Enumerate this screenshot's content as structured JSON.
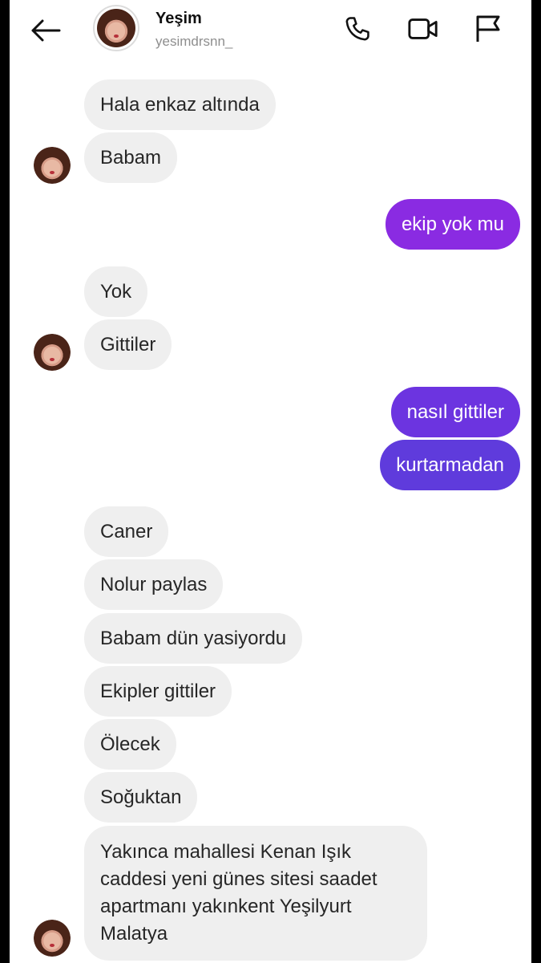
{
  "header": {
    "name": "Yeşim",
    "username": "yesimdrsnn_",
    "icons": [
      "back-arrow-icon",
      "phone-icon",
      "video-camera-icon",
      "flag-icon"
    ]
  },
  "colors": {
    "incoming_bg": "#efefef",
    "outgoing_purple": "#8a2be2",
    "outgoing_indigo": "#6435dd"
  },
  "messages": [
    {
      "from": "them",
      "text": "Hala enkaz altında"
    },
    {
      "from": "them",
      "text": "Babam"
    },
    {
      "from": "me",
      "text": "ekip yok mu"
    },
    {
      "from": "them",
      "text": "Yok"
    },
    {
      "from": "them",
      "text": "Gittiler"
    },
    {
      "from": "me",
      "text": "nasıl gittiler"
    },
    {
      "from": "me",
      "text": "kurtarmadan"
    },
    {
      "from": "them",
      "text": "Caner"
    },
    {
      "from": "them",
      "text": "Nolur paylas"
    },
    {
      "from": "them",
      "text": "Babam dün yasiyordu"
    },
    {
      "from": "them",
      "text": "Ekipler gittiler"
    },
    {
      "from": "them",
      "text": "Ölecek"
    },
    {
      "from": "them",
      "text": "Soğuktan"
    },
    {
      "from": "them",
      "text": "Yakınca mahallesi Kenan Işık caddesi yeni günes sitesi saadet apartmanı yakınkent Yeşilyurt Malatya"
    }
  ]
}
